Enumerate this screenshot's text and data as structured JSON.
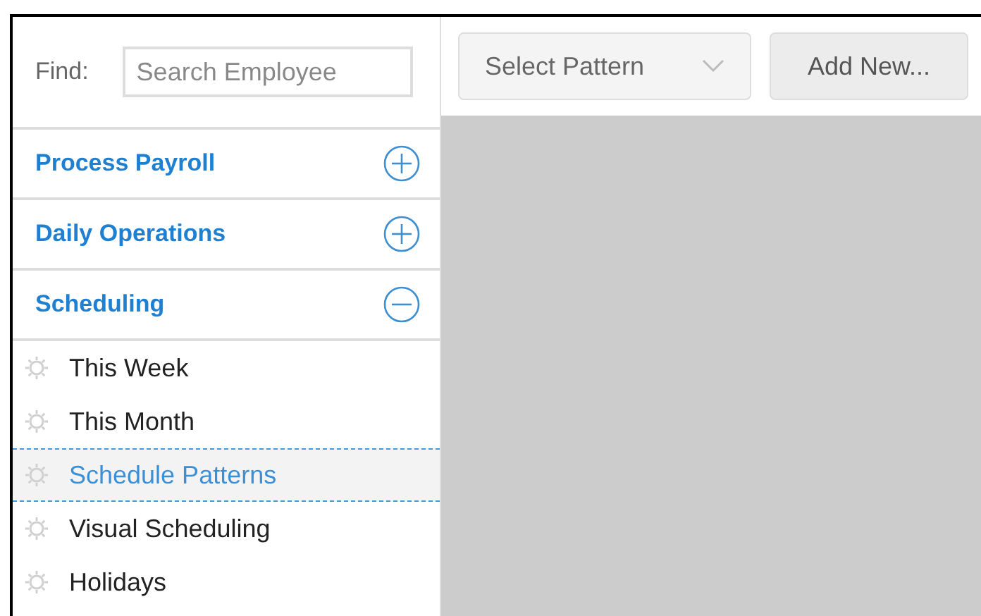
{
  "find": {
    "label": "Find:",
    "placeholder": "Search Employee"
  },
  "sections": [
    {
      "title": "Process Payroll",
      "expanded": false
    },
    {
      "title": "Daily Operations",
      "expanded": false
    },
    {
      "title": "Scheduling",
      "expanded": true,
      "items": [
        {
          "label": "This Week",
          "selected": false
        },
        {
          "label": "This Month",
          "selected": false
        },
        {
          "label": "Schedule Patterns",
          "selected": true
        },
        {
          "label": "Visual Scheduling",
          "selected": false
        },
        {
          "label": "Holidays",
          "selected": false
        }
      ]
    }
  ],
  "toolbar": {
    "select": {
      "placeholder": "Select Pattern"
    },
    "button": "Add New..."
  }
}
